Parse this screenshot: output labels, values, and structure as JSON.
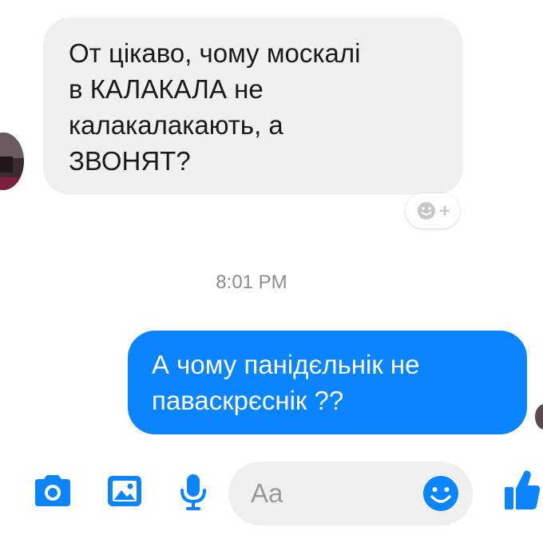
{
  "thread": {
    "incoming_message": {
      "lines": [
        "От цікаво, чому москалі",
        "в КАЛАКАЛА не",
        "калакалакають, а",
        "ЗВОНЯТ?"
      ]
    },
    "reaction_button": {
      "icon": "add-reaction-icon"
    },
    "timestamp": "8:01 PM",
    "outgoing_message": {
      "lines": [
        "А чому панідєльнік не",
        "паваскрєснік ??"
      ]
    }
  },
  "composer": {
    "placeholder": "Aa",
    "icons": {
      "camera": "camera-icon",
      "gallery": "image-icon",
      "microphone": "microphone-icon",
      "emoji": "emoji-icon",
      "like": "thumbs-up-icon"
    }
  },
  "colors": {
    "accent": "#0A84FF",
    "incoming_bubble": "#F1F0F0",
    "timestamp_text": "#8D8D8D"
  }
}
